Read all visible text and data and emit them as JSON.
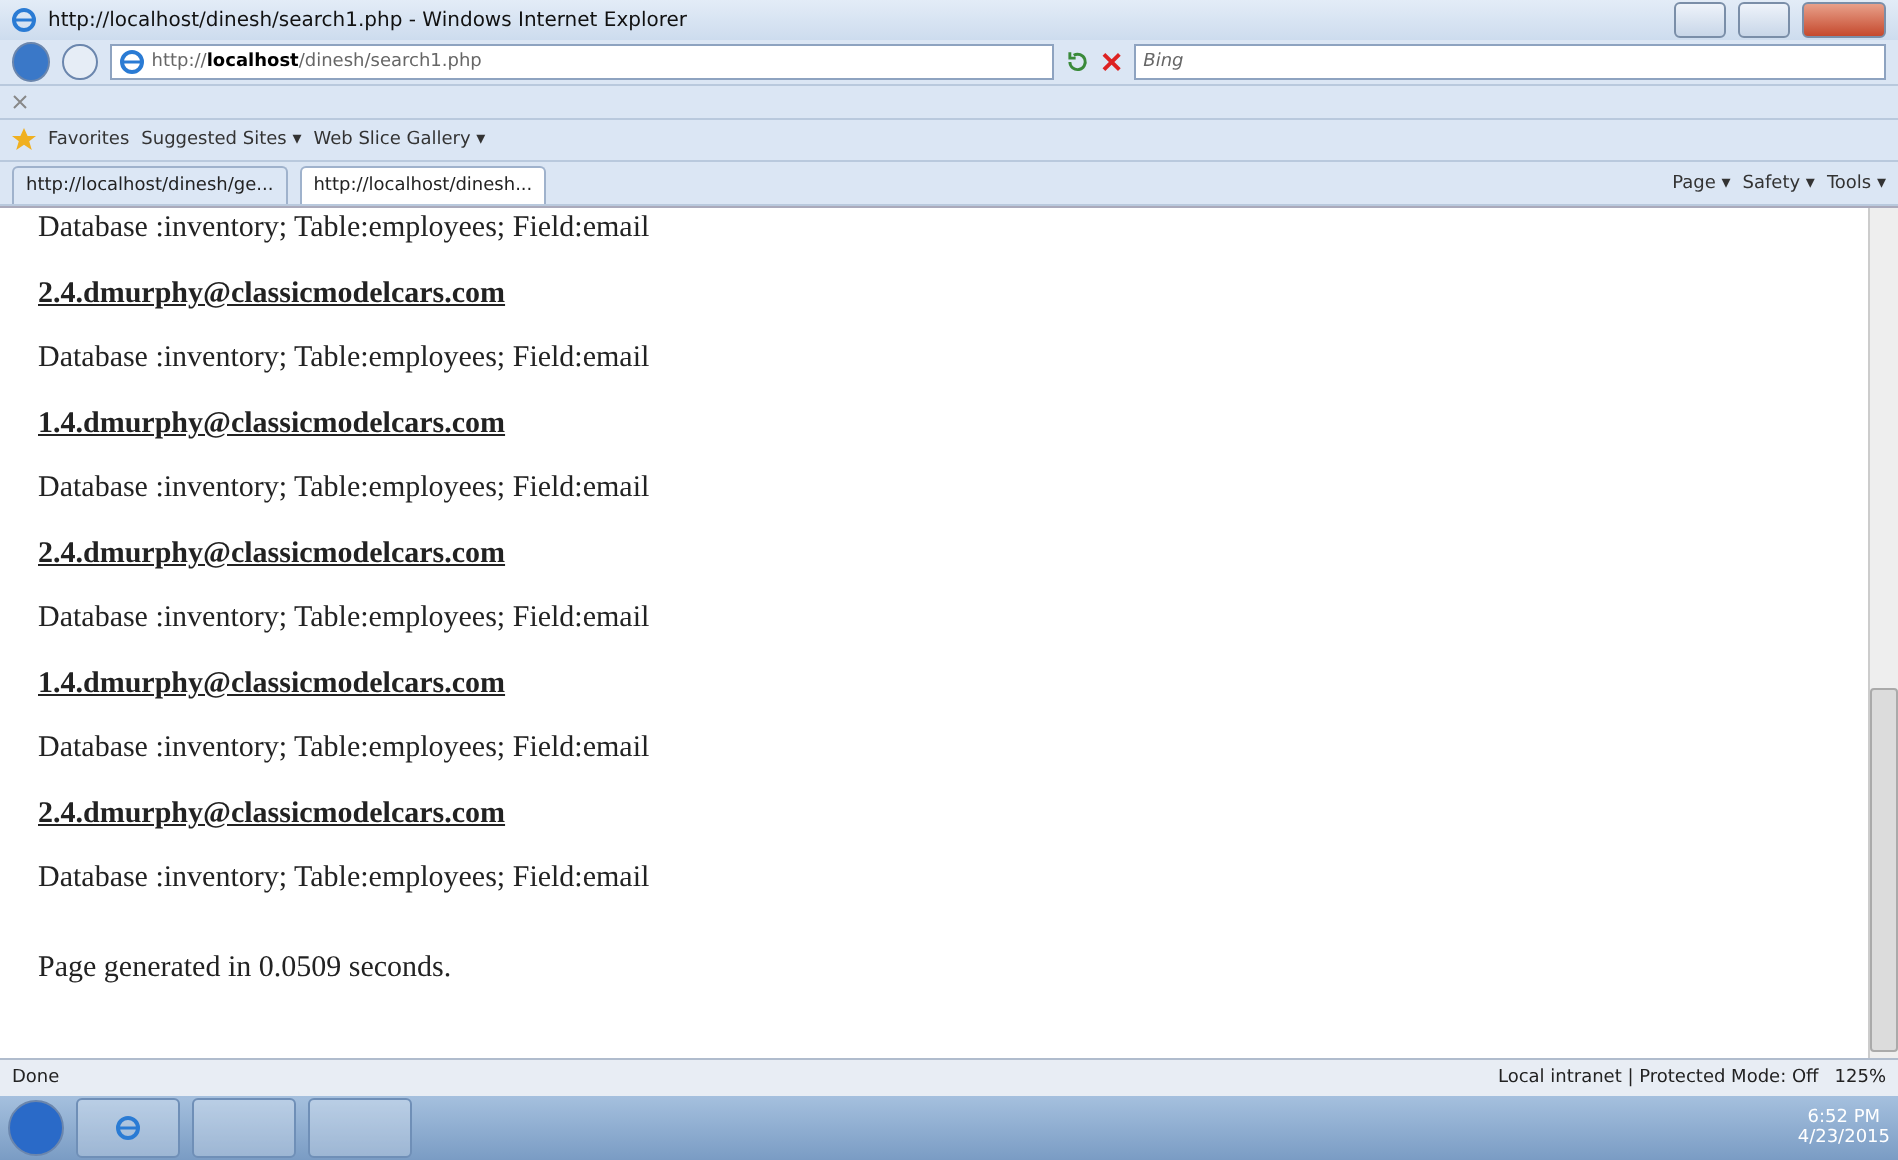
{
  "window": {
    "title": "http://localhost/dinesh/search1.php - Windows Internet Explorer"
  },
  "address_bar": {
    "url_prefix": "http://",
    "url_host": "localhost",
    "url_path": "/dinesh/search1.php",
    "search_placeholder": "Bing"
  },
  "favorites_bar": {
    "label": "Favorites",
    "links": [
      "Suggested Sites ▾",
      "Web Slice Gallery ▾"
    ]
  },
  "tabs": [
    {
      "label": "http://localhost/dinesh/ge...",
      "selected": false
    },
    {
      "label": "http://localhost/dinesh...",
      "selected": true
    }
  ],
  "command_bar": [
    "Page ▾",
    "Safety ▾",
    "Tools ▾"
  ],
  "content": {
    "cut_line": "Database :inventory; Table:employees; Field:email",
    "results": [
      {
        "link": "2.4.dmurphy@classicmodelcars.com",
        "detail": "Database :inventory; Table:employees; Field:email"
      },
      {
        "link": "1.4.dmurphy@classicmodelcars.com",
        "detail": "Database :inventory; Table:employees; Field:email"
      },
      {
        "link": "2.4.dmurphy@classicmodelcars.com",
        "detail": "Database :inventory; Table:employees; Field:email"
      },
      {
        "link": "1.4.dmurphy@classicmodelcars.com",
        "detail": "Database :inventory; Table:employees; Field:email"
      },
      {
        "link": "2.4.dmurphy@classicmodelcars.com",
        "detail": "Database :inventory; Table:employees; Field:email"
      }
    ],
    "footer": "Page generated in 0.0509 seconds."
  },
  "status_bar": {
    "status": "Done",
    "zone": "Local intranet | Protected Mode: Off",
    "zoom": "125%"
  },
  "taskbar": {
    "time": "6:52 PM",
    "date": "4/23/2015"
  }
}
